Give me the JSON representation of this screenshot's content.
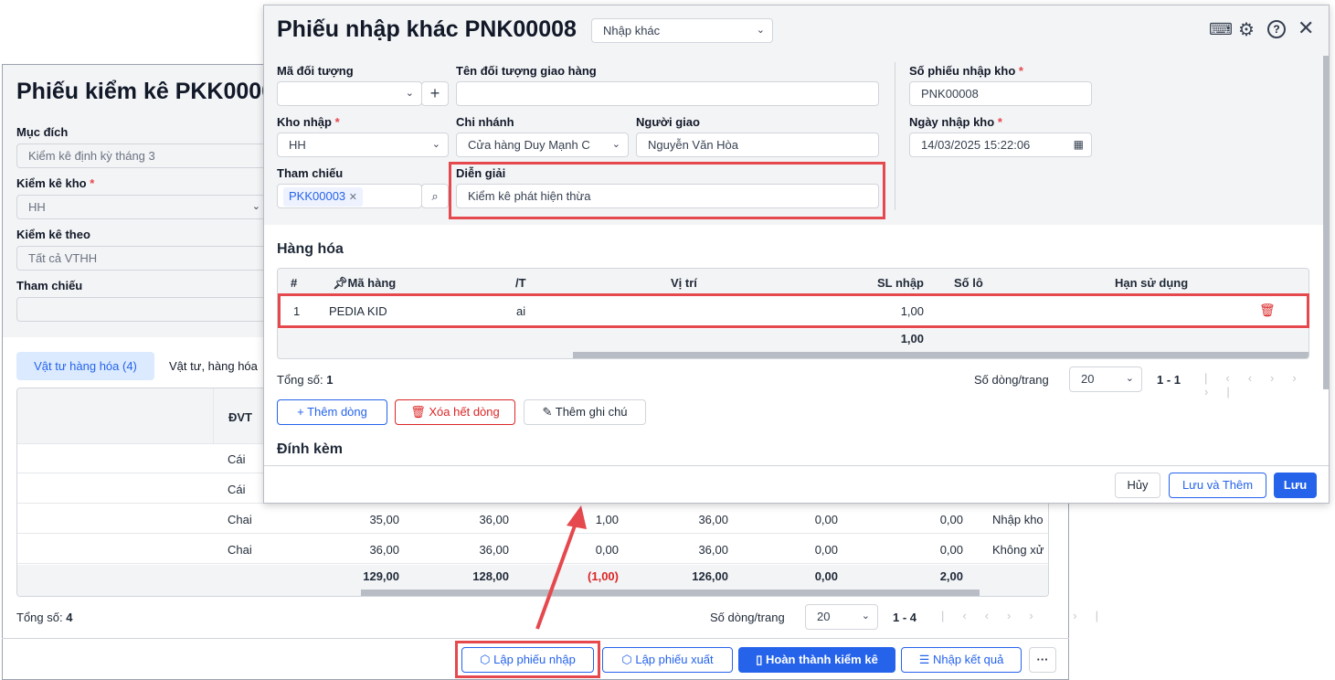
{
  "back": {
    "title": "Phiếu kiểm kê PKK0000",
    "muc_dich_label": "Mục đích",
    "muc_dich_value": "Kiểm kê định kỳ tháng 3",
    "kho_label": "Kiểm kê kho",
    "kho_value": "HH",
    "theo_label": "Kiểm kê theo",
    "theo_value": "Tất cả VTHH",
    "tham_chieu_label": "Tham chiếu",
    "tabs": [
      "Vật tư hàng hóa (4)",
      "Vật tư, hàng hóa"
    ],
    "col_dvt": "ĐVT",
    "rows": [
      {
        "dvt": "Cái",
        "v": []
      },
      {
        "dvt": "Cái",
        "v": []
      },
      {
        "dvt": "Chai",
        "v": [
          "35,00",
          "36,00",
          "1,00",
          "36,00",
          "0,00",
          "0,00"
        ],
        "xl": "Nhập kho"
      },
      {
        "dvt": "Chai",
        "v": [
          "36,00",
          "36,00",
          "0,00",
          "36,00",
          "0,00",
          "0,00"
        ],
        "xl": "Không xử"
      }
    ],
    "totals": [
      "129,00",
      "128,00",
      "(1,00)",
      "126,00",
      "0,00",
      "2,00"
    ],
    "total_label": "Tổng số:",
    "total_count": "4",
    "per_page_label": "Số dòng/trang",
    "per_page": "20",
    "range": "1 - 4",
    "actions": {
      "lap_nhap": "Lập phiếu nhập",
      "lap_xuat": "Lập phiếu xuất",
      "hoan_thanh": "Hoàn thành kiểm kê",
      "nhap_kq": "Nhập kết quả",
      "more": "···"
    }
  },
  "modal": {
    "title": "Phiếu nhập khác PNK00008",
    "type": "Nhập khác",
    "ma_doi_tuong_label": "Mã đối tượng",
    "ten_doi_tuong_label": "Tên đối tượng giao hàng",
    "so_phieu_label": "Số phiếu nhập kho",
    "so_phieu": "PNK00008",
    "kho_label": "Kho nhập",
    "kho": "HH",
    "chi_nhanh_label": "Chi nhánh",
    "chi_nhanh": "Cửa hàng Duy Mạnh C",
    "nguoi_giao_label": "Người giao",
    "nguoi_giao": "Nguyễn Văn Hòa",
    "ngay_label": "Ngày nhập kho",
    "ngay": "14/03/2025 15:22:06",
    "tham_chieu_label": "Tham chiếu",
    "tham_chieu_tag": "PKK00003",
    "dien_giai_label": "Diễn giải",
    "dien_giai": "Kiểm kê phát hiện thừa",
    "section_goods": "Hàng hóa",
    "cols": [
      "#",
      "Mã hàng",
      "/T",
      "Vị trí",
      "SL nhập",
      "Số lô",
      "Hạn sử dụng"
    ],
    "row": {
      "idx": "1",
      "ma": "PEDIA KID",
      "t": "ai",
      "sl": "1,00"
    },
    "total_sl": "1,00",
    "total_label": "Tổng số:",
    "total_count": "1",
    "per_page_label": "Số dòng/trang",
    "per_page": "20",
    "range": "1 - 1",
    "add_row": "Thêm dòng",
    "clear_rows": "Xóa hết dòng",
    "add_note": "Thêm ghi chú",
    "attach": "Đính kèm",
    "cancel": "Hủy",
    "save_add": "Lưu và Thêm",
    "save": "Lưu"
  }
}
